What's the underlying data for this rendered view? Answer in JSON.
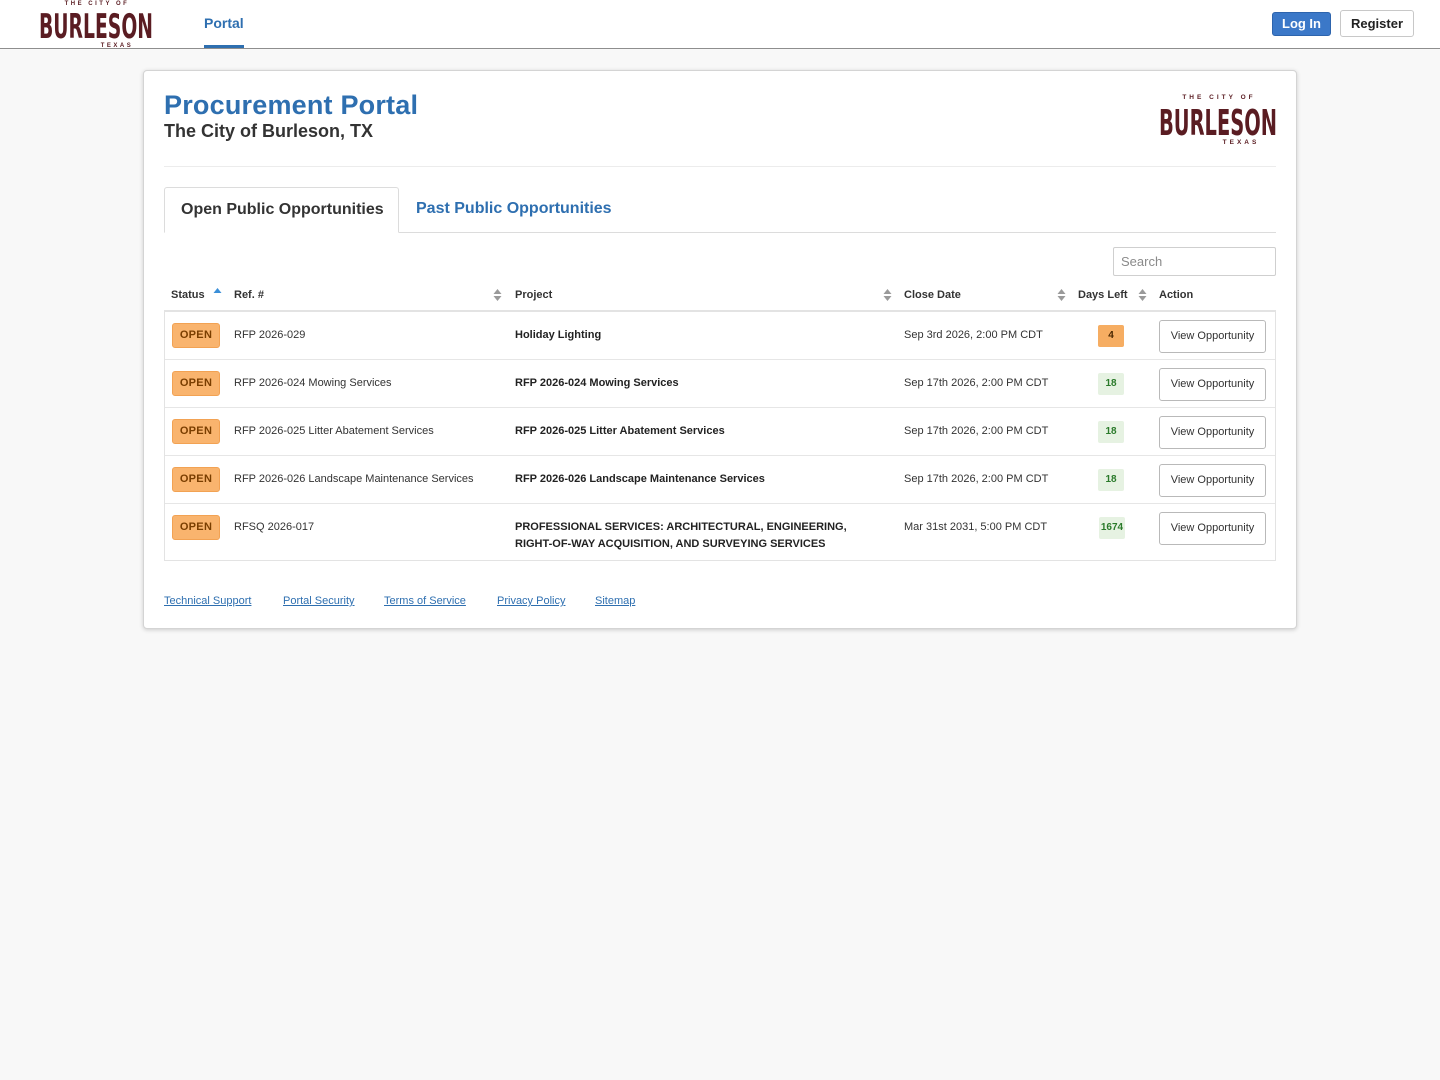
{
  "brand": {
    "logo_top": "THE CITY OF",
    "logo_main": "BURLESON",
    "logo_bottom": "TEXAS",
    "color_primary": "#2e6fb0",
    "color_logo": "#5a1c22"
  },
  "nav": {
    "portal_label": "Portal",
    "login_label": "Log In",
    "register_label": "Register"
  },
  "header": {
    "title": "Procurement Portal",
    "subtitle": "The City of Burleson, TX"
  },
  "tabs": [
    {
      "label": "Open Public Opportunities",
      "active": true
    },
    {
      "label": "Past Public Opportunities",
      "active": false
    }
  ],
  "search": {
    "placeholder": "Search"
  },
  "table": {
    "columns": [
      "Status",
      "Ref. #",
      "Project",
      "Close Date",
      "Days Left",
      "Action"
    ],
    "rows": [
      {
        "status": "OPEN",
        "ref": "RFP 2026-029",
        "project": "Holiday Lighting",
        "close_date": "Sep 3rd 2026, 2:00 PM CDT",
        "days_left": "4",
        "action": "View Opportunity"
      },
      {
        "status": "OPEN",
        "ref": "RFP 2026-024 Mowing Services",
        "project": "RFP 2026-024 Mowing Services",
        "close_date": "Sep 17th 2026, 2:00 PM CDT",
        "days_left": "18",
        "action": "View Opportunity"
      },
      {
        "status": "OPEN",
        "ref": "RFP 2026-025 Litter Abatement Services",
        "project": "RFP 2026-025 Litter Abatement Services",
        "close_date": "Sep 17th 2026, 2:00 PM CDT",
        "days_left": "18",
        "action": "View Opportunity"
      },
      {
        "status": "OPEN",
        "ref": "RFP 2026-026 Landscape Maintenance Services",
        "project": "RFP 2026-026 Landscape Maintenance Services",
        "close_date": "Sep 17th 2026, 2:00 PM CDT",
        "days_left": "18",
        "action": "View Opportunity"
      },
      {
        "status": "OPEN",
        "ref": "RFSQ 2026-017",
        "project_line1": "PROFESSIONAL SERVICES: ARCHITECTURAL, ENGINEERING,",
        "project_line2": "RIGHT-OF-WAY ACQUISITION, AND SURVEYING SERVICES",
        "close_date": "Mar 31st 2031, 5:00 PM CDT",
        "days_left": "1674",
        "action": "View Opportunity"
      }
    ]
  },
  "footer": {
    "links": [
      "Technical Support",
      "Portal Security",
      "Terms of Service",
      "Privacy Policy",
      "Sitemap"
    ]
  }
}
